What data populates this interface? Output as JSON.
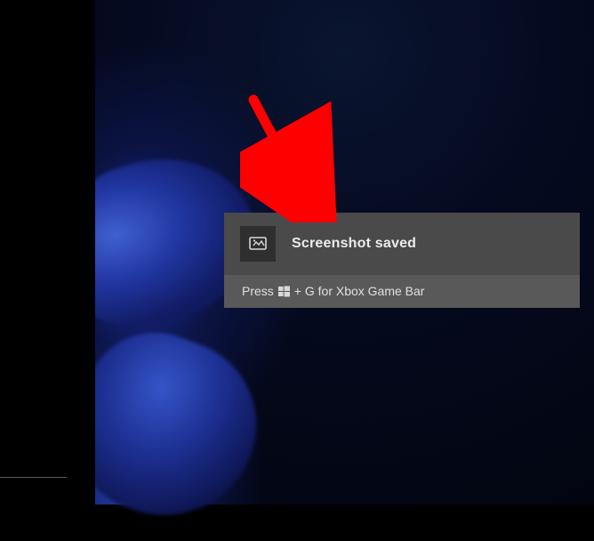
{
  "notification": {
    "title": "Screenshot saved",
    "hint_prefix": "Press",
    "hint_suffix": "+ G for Xbox Game Bar",
    "icon_name": "screenshot-icon",
    "win_key_icon": "windows-logo-icon"
  },
  "annotation": {
    "arrow_color": "#ff0000"
  }
}
